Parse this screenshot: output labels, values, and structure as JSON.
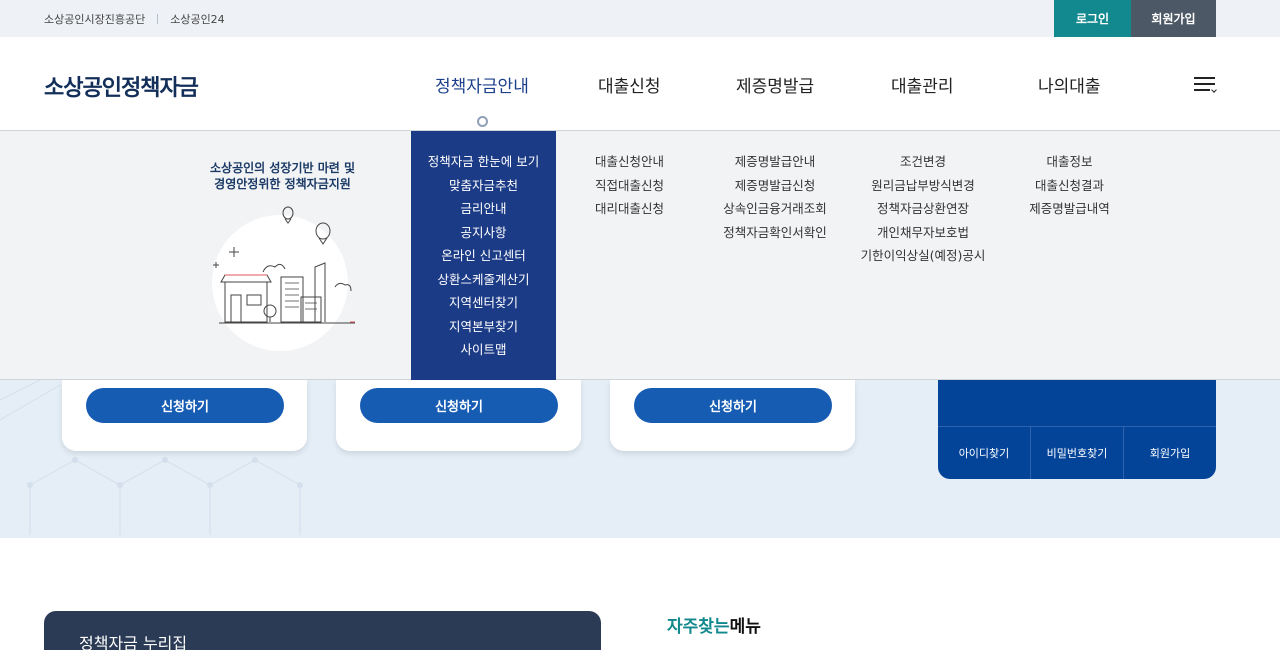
{
  "topbar": {
    "site1": "소상공인시장진흥공단",
    "site2": "소상공인24",
    "login": "로그인",
    "join": "회원가입"
  },
  "header": {
    "logo": "소상공인정책자금",
    "nav": [
      {
        "label": "정책자금안내"
      },
      {
        "label": "대출신청"
      },
      {
        "label": "제증명발급"
      },
      {
        "label": "대출관리"
      },
      {
        "label": "나의대출"
      }
    ],
    "menu_icon": "hamburger-menu-icon"
  },
  "mega": {
    "intro_line1": "소상공인의 성장기반 마련 및",
    "intro_line2": "경영안정위한 정책자금지원",
    "col1": [
      "정책자금 한눈에 보기",
      "맞춤자금추천",
      "금리안내",
      "공지사항",
      "온라인 신고센터",
      "상환스케줄계산기",
      "지역센터찾기",
      "지역본부찾기",
      "사이트맵"
    ],
    "col2": [
      "대출신청안내",
      "직접대출신청",
      "대리대출신청"
    ],
    "col3": [
      "제증명발급안내",
      "제증명발급신청",
      "상속인금융거래조회",
      "정책자금확인서확인"
    ],
    "col4": [
      "조건변경",
      "원리금납부방식변경",
      "정책자금상환연장",
      "개인채무자보호법",
      "기한이익상실(예정)공시"
    ],
    "col5": [
      "대출정보",
      "대출신청결과",
      "제증명발급내역"
    ]
  },
  "cards": {
    "apply_label": "신청하기"
  },
  "login_box": {
    "find_id": "아이디찾기",
    "find_pw": "비밀번호찾기",
    "join": "회원가입"
  },
  "lower": {
    "nurizip": "정책자금 누리집",
    "faq_accent": "자주찾는",
    "faq_rest": "메뉴"
  },
  "colors": {
    "login_btn": "#12898e",
    "join_btn": "#4d5866",
    "active_menu": "#1c3b86",
    "apply_btn": "#175cb3",
    "login_box": "#034499",
    "logo": "#132f59"
  }
}
